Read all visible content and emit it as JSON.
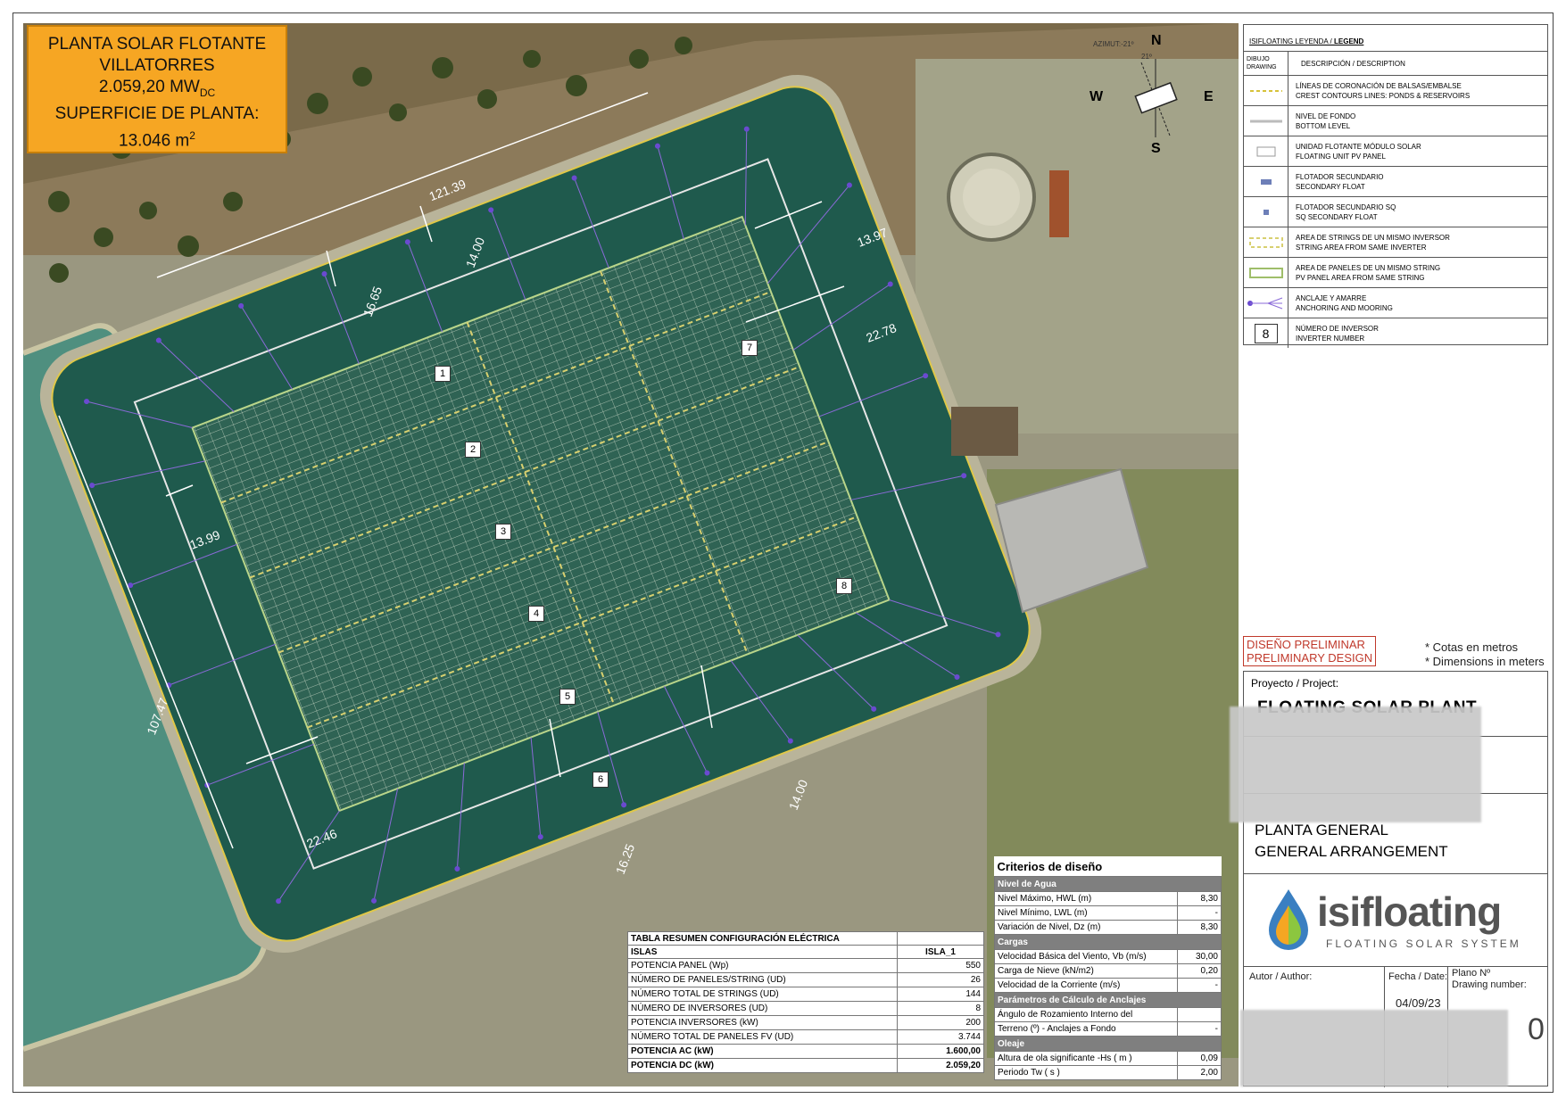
{
  "title_box": {
    "line1": "PLANTA SOLAR FLOTANTE",
    "line2": "VILLATORRES",
    "power_value": "2.059,20 MW",
    "power_sub": "DC",
    "line4": "SUPERFICIE DE PLANTA:",
    "area_value": "13.046 m",
    "area_sup": "2"
  },
  "dimensions": {
    "d1": "121.39",
    "d2": "14.00",
    "d3": "16.65",
    "d4": "13.97",
    "d5": "22.78",
    "d6": "13.99",
    "d7": "107.47",
    "d8": "22.46",
    "d9": "16.25",
    "d10": "14.00"
  },
  "inverters": [
    "1",
    "2",
    "3",
    "4",
    "5",
    "6",
    "7",
    "8"
  ],
  "compass": {
    "azimut": "AZIMUT:-21º",
    "n": "N",
    "s": "S",
    "e": "E",
    "w": "W",
    "angle": "21º"
  },
  "legend": {
    "header_a": "ISIFLOATING LEYENDA / ",
    "header_b": "LEGEND",
    "col1": "DIBUJO DRAWING",
    "col2": "DESCRIPCIÓN / DESCRIPTION",
    "items": [
      {
        "es": "LÍNEAS DE CORONACIÓN DE BALSAS/EMBALSE",
        "en": "CREST CONTOURS LINES: PONDS & RESERVOIRS"
      },
      {
        "es": "NIVEL DE FONDO",
        "en": "BOTTOM LEVEL"
      },
      {
        "es": "UNIDAD FLOTANTE MÓDULO SOLAR",
        "en": "FLOATING UNIT PV PANEL"
      },
      {
        "es": "FLOTADOR SECUNDARIO",
        "en": "SECONDARY FLOAT"
      },
      {
        "es": "FLOTADOR SECUNDARIO SQ",
        "en": "SQ SECONDARY FLOAT"
      },
      {
        "es": "AREA DE STRINGS DE UN MISMO INVERSOR",
        "en": "STRING AREA FROM SAME INVERTER"
      },
      {
        "es": "AREA DE PANELES DE UN MISMO STRING",
        "en": "PV PANEL AREA FROM SAME STRING"
      },
      {
        "es": "ANCLAJE Y AMARRE",
        "en": "ANCHORING AND MOORING"
      },
      {
        "es": "NÚMERO DE INVERSOR",
        "en": "INVERTER NUMBER",
        "sym": "8"
      }
    ]
  },
  "prelim": {
    "es": "DISEÑO PRELIMINAR",
    "en": "PRELIMINARY DESIGN"
  },
  "notes": {
    "es": "* Cotas en metros",
    "en": "* Dimensions in meters"
  },
  "cartouche": {
    "project_label": "Proyecto / Project:",
    "project_name": "FLOATING SOLAR PLANT",
    "plan_es": "PLANTA GENERAL",
    "plan_en": "GENERAL ARRANGEMENT",
    "logo_name": "isifloating",
    "logo_tag": "FLOATING SOLAR SYSTEM",
    "author": "Autor / Author:",
    "date_label": "Fecha / Date:",
    "date_value": "04/09/23",
    "plan_no": "Plano Nº",
    "drawing_no": "Drawing number:",
    "partial_digit": "0"
  },
  "criteria": {
    "title": "Criterios de diseño",
    "sections": [
      {
        "name": "Nivel de Agua",
        "rows": [
          {
            "label": "Nivel Máximo, HWL (m)",
            "value": "8,30"
          },
          {
            "label": "Nivel Mínimo, LWL (m)",
            "value": "-"
          },
          {
            "label": "Variación de Nivel, Dz (m)",
            "value": "8,30"
          }
        ]
      },
      {
        "name": "Cargas",
        "rows": [
          {
            "label": "Velocidad Básica del Viento, Vb (m/s)",
            "value": "30,00"
          },
          {
            "label": "Carga de Nieve (kN/m2)",
            "value": "0,20"
          },
          {
            "label": "Velocidad de la Corriente (m/s)",
            "value": "-"
          }
        ]
      },
      {
        "name": "Parámetros de Cálculo de Anclajes",
        "rows": [
          {
            "label": "Ángulo de Rozamiento Interno del",
            "value": ""
          },
          {
            "label": " Terreno (º) - Anclajes a Fondo",
            "value": "-"
          }
        ]
      },
      {
        "name": "Oleaje",
        "rows": [
          {
            "label": "Altura de ola significante  -Hs ( m )",
            "value": "0,09"
          },
          {
            "label": "Periodo Tw ( s )",
            "value": "2,00"
          }
        ]
      }
    ]
  },
  "electrical": {
    "title": "TABLA RESUMEN CONFIGURACIÓN ELÉCTRICA",
    "col_islas": "ISLAS",
    "col_isla1": "ISLA_1",
    "rows": [
      {
        "label": "POTENCIA PANEL (Wp)",
        "value": "550"
      },
      {
        "label": "NÚMERO DE PANELES/STRING (UD)",
        "value": "26"
      },
      {
        "label": "NÚMERO TOTAL DE STRINGS (UD)",
        "value": "144"
      },
      {
        "label": "NÚMERO DE INVERSORES (UD)",
        "value": "8"
      },
      {
        "label": "POTENCIA INVERSORES (kW)",
        "value": "200"
      },
      {
        "label": "NÚMERO TOTAL DE PANELES FV (UD)",
        "value": "3.744"
      },
      {
        "label": "POTENCIA AC (kW)",
        "value": "1.600,00"
      },
      {
        "label": "POTENCIA DC (kW)",
        "value": "2.059,20"
      }
    ]
  }
}
